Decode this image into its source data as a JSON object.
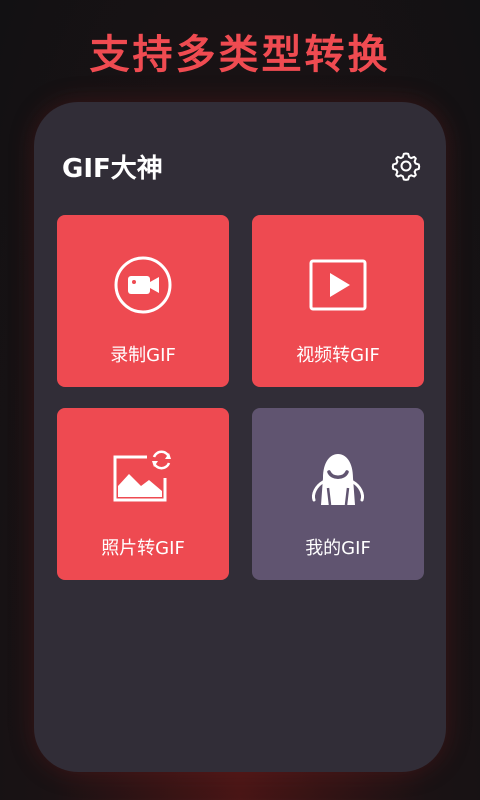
{
  "headline": "支持多类型转换",
  "app": {
    "title": "GIF大神",
    "settings_icon": "gear-icon"
  },
  "tiles": [
    {
      "label": "录制GIF",
      "icon": "video-camera-icon",
      "color": "#ee4a51"
    },
    {
      "label": "视频转GIF",
      "icon": "play-icon",
      "color": "#ee4a51"
    },
    {
      "label": "照片转GIF",
      "icon": "photo-convert-icon",
      "color": "#ee4a51"
    },
    {
      "label": "我的GIF",
      "icon": "mascot-icon",
      "color": "#605470"
    }
  ],
  "colors": {
    "accent": "#ef4b51",
    "card": "#312d37",
    "tile_secondary": "#605470"
  }
}
